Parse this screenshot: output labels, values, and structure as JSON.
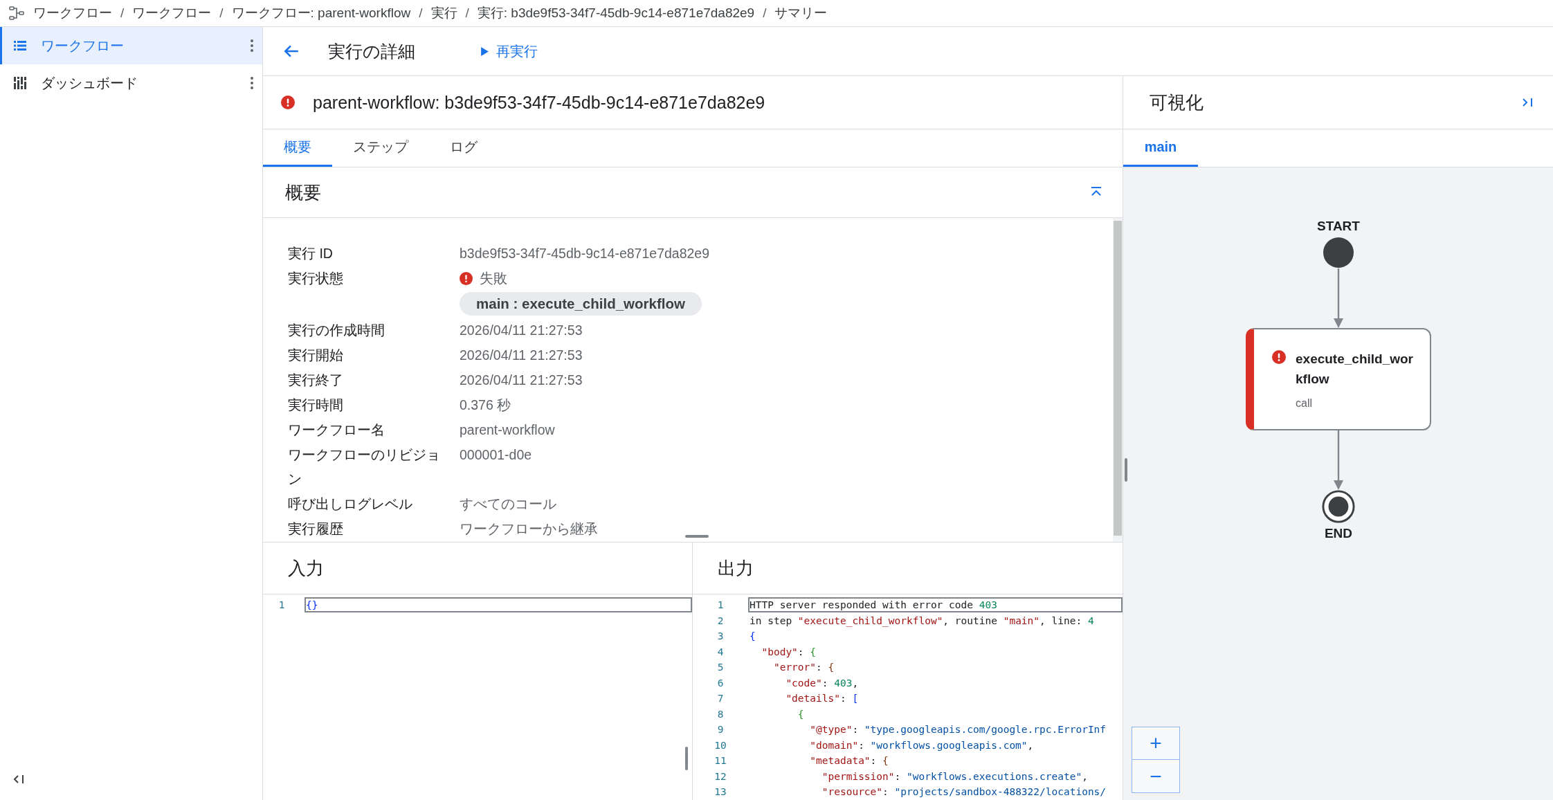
{
  "breadcrumb": {
    "separator": "/",
    "items": [
      "ワークフロー",
      "ワークフロー",
      "ワークフロー: parent-workflow",
      "実行",
      "実行: b3de9f53-34f7-45db-9c14-e871e7da82e9",
      "サマリー"
    ]
  },
  "sidebar": {
    "items": [
      {
        "label": "ワークフロー",
        "kind": "list",
        "selected": true
      },
      {
        "label": "ダッシュボード",
        "kind": "dashboard",
        "selected": false
      }
    ]
  },
  "header": {
    "title": "実行の詳細",
    "rerun": "再実行"
  },
  "execution": {
    "title": "parent-workflow: b3de9f53-34f7-45db-9c14-e871e7da82e9",
    "failed": true
  },
  "tabs": [
    {
      "label": "概要",
      "selected": true
    },
    {
      "label": "ステップ",
      "selected": false
    },
    {
      "label": "ログ",
      "selected": false
    }
  ],
  "summary": {
    "title": "概要",
    "expanded": true,
    "fields": [
      {
        "label": "実行 ID",
        "value": "b3de9f53-34f7-45db-9c14-e871e7da82e9",
        "kind": "text"
      },
      {
        "label": "実行状態",
        "value": "失敗",
        "kind": "status",
        "failed": true,
        "chip": "main  **: execute_child_workflow**"
      },
      {
        "label": "実行の作成時間",
        "value": "2026/04/11 21:27:53",
        "kind": "text"
      },
      {
        "label": "実行開始",
        "value": "2026/04/11 21:27:53",
        "kind": "text"
      },
      {
        "label": "実行終了",
        "value": "2026/04/11 21:27:53",
        "kind": "text"
      },
      {
        "label": "実行時間",
        "value": "0.376 秒",
        "kind": "text"
      },
      {
        "label": "ワークフロー名",
        "value": "parent-workflow",
        "kind": "text"
      },
      {
        "label": "ワークフローのリビジョン",
        "value": "000001-d0e",
        "kind": "text"
      },
      {
        "label": "呼び出しログレベル",
        "value": "すべてのコール",
        "kind": "text"
      },
      {
        "label": "実行履歴",
        "value": "ワークフローから継承",
        "kind": "text"
      }
    ]
  },
  "input": {
    "title": "入力",
    "lines": [
      {
        "number": "1",
        "highlighted": true,
        "tokens": [
          {
            "text": "{}",
            "kind": "outer"
          }
        ]
      }
    ]
  },
  "output": {
    "title": "出力",
    "lines": [
      {
        "number": "1",
        "highlighted": true,
        "tokens": [
          {
            "text": "HTTP server responded with error code ",
            "kind": "plain"
          },
          {
            "text": "403",
            "kind": "number"
          }
        ]
      },
      {
        "number": "2",
        "highlighted": false,
        "tokens": [
          {
            "text": "in step ",
            "kind": "plain"
          },
          {
            "text": "\"execute_child_workflow\"",
            "kind": "key"
          },
          {
            "text": ", routine ",
            "kind": "plain"
          },
          {
            "text": "\"main\"",
            "kind": "key"
          },
          {
            "text": ", line: ",
            "kind": "plain"
          },
          {
            "text": "4",
            "kind": "number"
          }
        ]
      },
      {
        "number": "3",
        "highlighted": false,
        "tokens": [
          {
            "text": "{",
            "kind": "outer"
          }
        ]
      },
      {
        "number": "4",
        "highlighted": false,
        "tokens": [
          {
            "text": "  \"body\"",
            "kind": "key"
          },
          {
            "text": ": ",
            "kind": "plain"
          },
          {
            "text": "{",
            "kind": "inner"
          }
        ]
      },
      {
        "number": "5",
        "highlighted": false,
        "tokens": [
          {
            "text": "    \"error\"",
            "kind": "key"
          },
          {
            "text": ": ",
            "kind": "plain"
          },
          {
            "text": "{",
            "kind": "deep"
          }
        ]
      },
      {
        "number": "6",
        "highlighted": false,
        "tokens": [
          {
            "text": "      \"code\"",
            "kind": "key"
          },
          {
            "text": ": ",
            "kind": "plain"
          },
          {
            "text": "403",
            "kind": "number"
          },
          {
            "text": ",",
            "kind": "plain"
          }
        ]
      },
      {
        "number": "7",
        "highlighted": false,
        "tokens": [
          {
            "text": "      \"details\"",
            "kind": "key"
          },
          {
            "text": ": ",
            "kind": "plain"
          },
          {
            "text": "[",
            "kind": "outer"
          }
        ]
      },
      {
        "number": "8",
        "highlighted": false,
        "tokens": [
          {
            "text": "        {",
            "kind": "inner"
          }
        ]
      },
      {
        "number": "9",
        "highlighted": false,
        "tokens": [
          {
            "text": "          \"@type\"",
            "kind": "key"
          },
          {
            "text": ": ",
            "kind": "plain"
          },
          {
            "text": "\"type.googleapis.com/google.rpc.ErrorInf",
            "kind": "string"
          }
        ]
      },
      {
        "number": "10",
        "highlighted": false,
        "tokens": [
          {
            "text": "          \"domain\"",
            "kind": "key"
          },
          {
            "text": ": ",
            "kind": "plain"
          },
          {
            "text": "\"workflows.googleapis.com\"",
            "kind": "string"
          },
          {
            "text": ",",
            "kind": "plain"
          }
        ]
      },
      {
        "number": "11",
        "highlighted": false,
        "tokens": [
          {
            "text": "          \"metadata\"",
            "kind": "key"
          },
          {
            "text": ": ",
            "kind": "plain"
          },
          {
            "text": "{",
            "kind": "deep"
          }
        ]
      },
      {
        "number": "12",
        "highlighted": false,
        "tokens": [
          {
            "text": "            \"permission\"",
            "kind": "key"
          },
          {
            "text": ": ",
            "kind": "plain"
          },
          {
            "text": "\"workflows.executions.create\"",
            "kind": "string"
          },
          {
            "text": ",",
            "kind": "plain"
          }
        ]
      },
      {
        "number": "13",
        "highlighted": false,
        "tokens": [
          {
            "text": "            \"resource\"",
            "kind": "key"
          },
          {
            "text": ": ",
            "kind": "plain"
          },
          {
            "text": "\"projects/sandbox-488322/locations/",
            "kind": "string"
          }
        ]
      }
    ]
  },
  "visualization": {
    "title": "可視化",
    "tabs": [
      {
        "label": "main",
        "selected": true
      }
    ],
    "start": "START",
    "end": "END",
    "step": {
      "name": "execute_child_workflow",
      "type": "call",
      "failed": true
    },
    "zoom": [
      "+",
      "−"
    ]
  }
}
